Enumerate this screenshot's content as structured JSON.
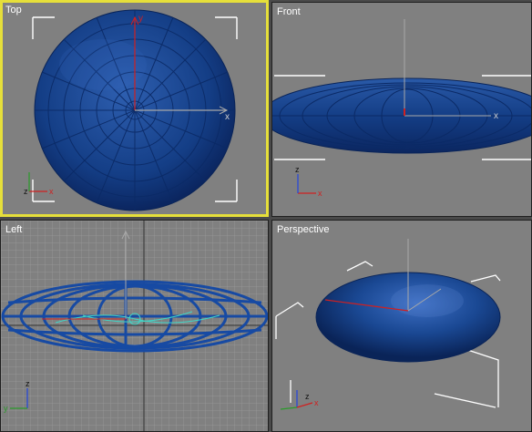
{
  "viewports": {
    "top": {
      "label": "Top",
      "active": true
    },
    "front": {
      "label": "Front",
      "active": false
    },
    "left": {
      "label": "Left",
      "active": false
    },
    "perspective": {
      "label": "Perspective",
      "active": false
    }
  },
  "axis_labels": {
    "x": "x",
    "y": "y",
    "z": "z"
  },
  "colors": {
    "viewport_bg": "#808080",
    "active_border": "#e6df3a",
    "object_blue": "#1d4b94",
    "wire_blue": "#174aa3",
    "axis_x": "#d02020",
    "axis_y": "#2a9a2a",
    "axis_z": "#2244dd",
    "bracket": "#ffffff",
    "cyan_wire": "#3fd6c8"
  },
  "icons": [
    "axis-tripod-icon",
    "transform-gizmo-icon",
    "selection-bracket-icon"
  ]
}
